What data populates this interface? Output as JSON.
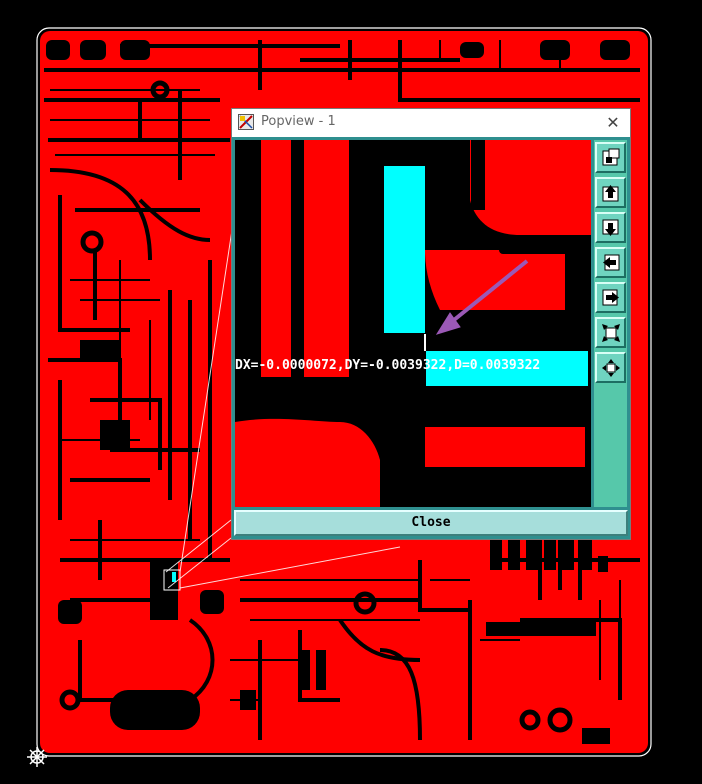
{
  "window": {
    "title": "Popview - 1",
    "close_glyph": "✕",
    "close_button_label": "Close"
  },
  "measurement": {
    "readout": "DX=-0.0000072,DY=-0.0039322,D=0.0039322"
  },
  "toolbar": {
    "buttons": [
      {
        "name": "zoom-fit-icon"
      },
      {
        "name": "pan-up-icon"
      },
      {
        "name": "pan-down-icon"
      },
      {
        "name": "pan-left-icon"
      },
      {
        "name": "pan-right-icon"
      },
      {
        "name": "zoom-in-icon"
      },
      {
        "name": "zoom-out-icon"
      }
    ]
  },
  "colors": {
    "copper": "#ff0000",
    "background": "#000000",
    "highlight": "#00ffff",
    "annotation_arrow": "#9b59b6",
    "toolbar": "#56c8aa",
    "close_bar": "#a6dedb"
  }
}
